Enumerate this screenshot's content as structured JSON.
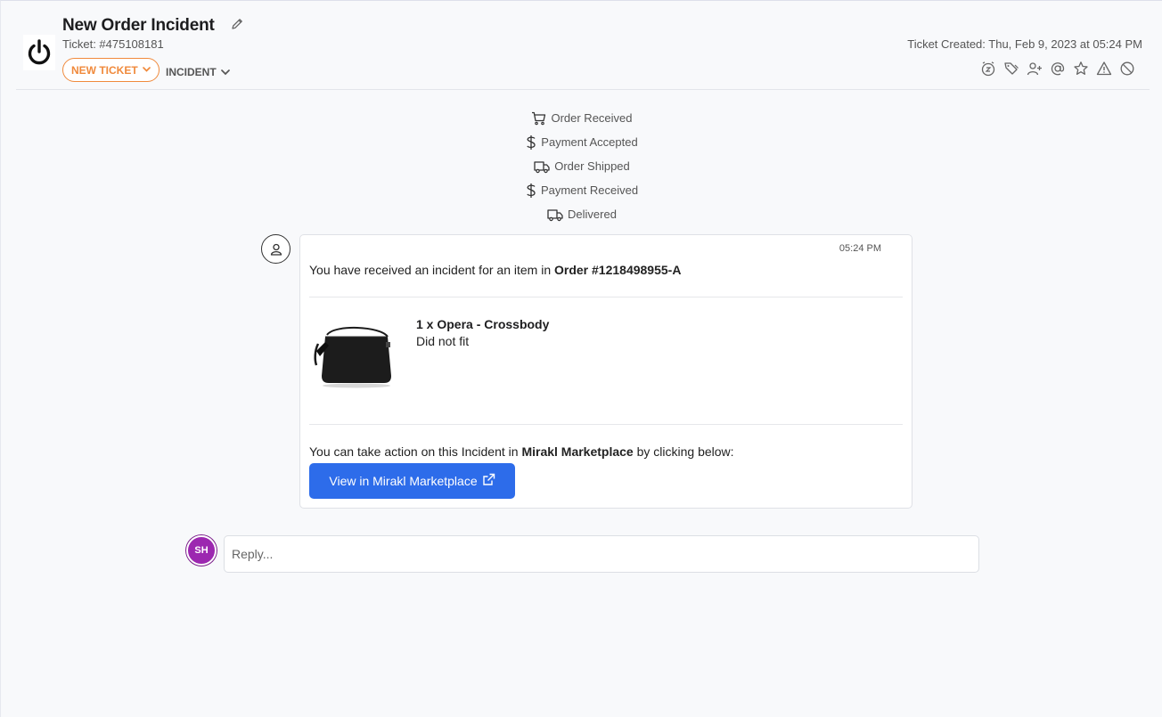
{
  "header": {
    "title": "New Order Incident",
    "ticket_id": "Ticket: #475108181",
    "status": "NEW TICKET",
    "type": "INCIDENT",
    "created": "Ticket Created: Thu, Feb 9, 2023 at 05:24 PM",
    "accent_color": "#f08a3c",
    "toolbar_icons": [
      "snooze-icon",
      "tag-icon",
      "assign-user-icon",
      "mention-icon",
      "star-icon",
      "warning-icon",
      "block-icon"
    ]
  },
  "timeline": [
    {
      "label": "Order Received",
      "icon": "cart-icon"
    },
    {
      "label": "Payment Accepted",
      "icon": "dollar-icon"
    },
    {
      "label": "Order Shipped",
      "icon": "truck-icon"
    },
    {
      "label": "Payment Received",
      "icon": "dollar-icon"
    },
    {
      "label": "Delivered",
      "icon": "truck-icon"
    }
  ],
  "message": {
    "time": "05:24 PM",
    "intro": "You have received an incident for an item in ",
    "order": "Order #1218498955-A",
    "product_name": "1 x Opera - Crossbody",
    "product_reason": "Did not fit",
    "action_pre": "You can take action on this Incident in ",
    "marketplace": "Mirakl Marketplace",
    "action_post": " by clicking below:",
    "button_label": "View in Mirakl Marketplace",
    "button_color": "#2d6cea"
  },
  "reply": {
    "avatar_initials": "SH",
    "avatar_color": "#9c27b0",
    "placeholder": "Reply..."
  }
}
